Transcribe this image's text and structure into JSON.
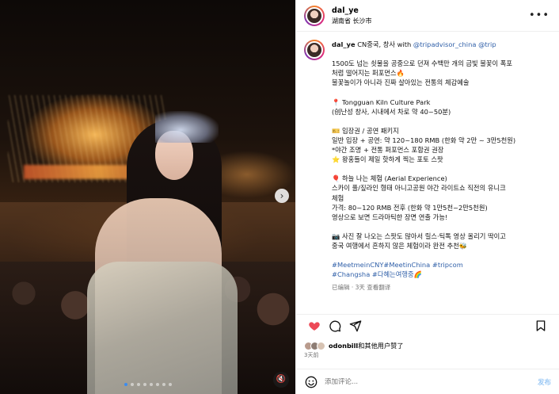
{
  "header": {
    "username": "dal_ye",
    "location": "湖南省 长沙市",
    "more_icon": "more-icon"
  },
  "caption": {
    "username": "dal_ye",
    "lines": [
      {
        "kind": "with",
        "prefix": "CN중국, 창사 with ",
        "mention1": "@tripadvisor_china",
        "mention2": "@trip"
      },
      {
        "kind": "gap"
      },
      {
        "kind": "text",
        "text": "1500도 넘는 쇳물을 공중으로 던져 수백만 개의 금빛 불꽃이 폭포"
      },
      {
        "kind": "text",
        "text": "처럼 떨어지는 퍼포먼스🔥"
      },
      {
        "kind": "text",
        "text": "불꽃놀이가 아니라 진짜 살아있는 전통의 체감예술"
      },
      {
        "kind": "gap"
      },
      {
        "kind": "text",
        "text": "📍 Tongguan Kiln Culture Park"
      },
      {
        "kind": "text",
        "text": "(创난성 창사, 시내에서 차로 약 40~50분)"
      },
      {
        "kind": "gap"
      },
      {
        "kind": "text",
        "text": "🎫 입장권 / 공연 패키지"
      },
      {
        "kind": "text",
        "text": "일반 입장 + 공연: 약 120~180 RMB (한화 약 2만 ~ 3만5천원)"
      },
      {
        "kind": "text",
        "text": "*야간 조명 + 전통 퍼포먼스 포함권 권장"
      },
      {
        "kind": "text",
        "text": "⭐ 왕홍들이 제일 핫하게 찍는 포토 스팟"
      },
      {
        "kind": "gap"
      },
      {
        "kind": "text",
        "text": "🎈 하늘 나는 체험 (Aerial Experience)"
      },
      {
        "kind": "text",
        "text": "스카이 풀/짚라인 형태 아니고공원 야간 라이트쇼 직전의 유니크"
      },
      {
        "kind": "text",
        "text": "체험"
      },
      {
        "kind": "text",
        "text": "가격: 80~120 RMB 전후 (한화 약 1만5천~2만5천원)"
      },
      {
        "kind": "text",
        "text": "영상으로 보면 드라마틱한 장면 연출 가능!"
      },
      {
        "kind": "gap"
      },
      {
        "kind": "text",
        "text": "📷 사진 잘 나오는 스팟도 많아서 릴스·틱톡 영상 올리기 딱이고"
      },
      {
        "kind": "text",
        "text": "중국 여행에서 흔하지 않은 체험이라 완전 추천🐝"
      },
      {
        "kind": "gap"
      },
      {
        "kind": "tags",
        "text": "#MeetmeinCNY#MeetinChina #tripcom"
      },
      {
        "kind": "tags2",
        "text": "#Changsha",
        "tail": "#다혜는여행중🌈"
      }
    ],
    "meta": "已编辑 · 3天  查看翻译"
  },
  "actions": {
    "like_icon": "heart-icon",
    "comment_icon": "comment-icon",
    "share_icon": "share-icon",
    "save_icon": "bookmark-icon",
    "like_color": "#ed4956"
  },
  "likes": {
    "user": "odonbill",
    "rest": "和其他用户赞了"
  },
  "time_ago": "3天前",
  "comment_bar": {
    "emoji_icon": "emoji-icon",
    "placeholder": "添加评论...",
    "post_label": "发布"
  },
  "media": {
    "dot_count": 8,
    "active_dot": 0,
    "next_icon": "chevron-right-icon",
    "mute_icon": "mute-icon"
  }
}
